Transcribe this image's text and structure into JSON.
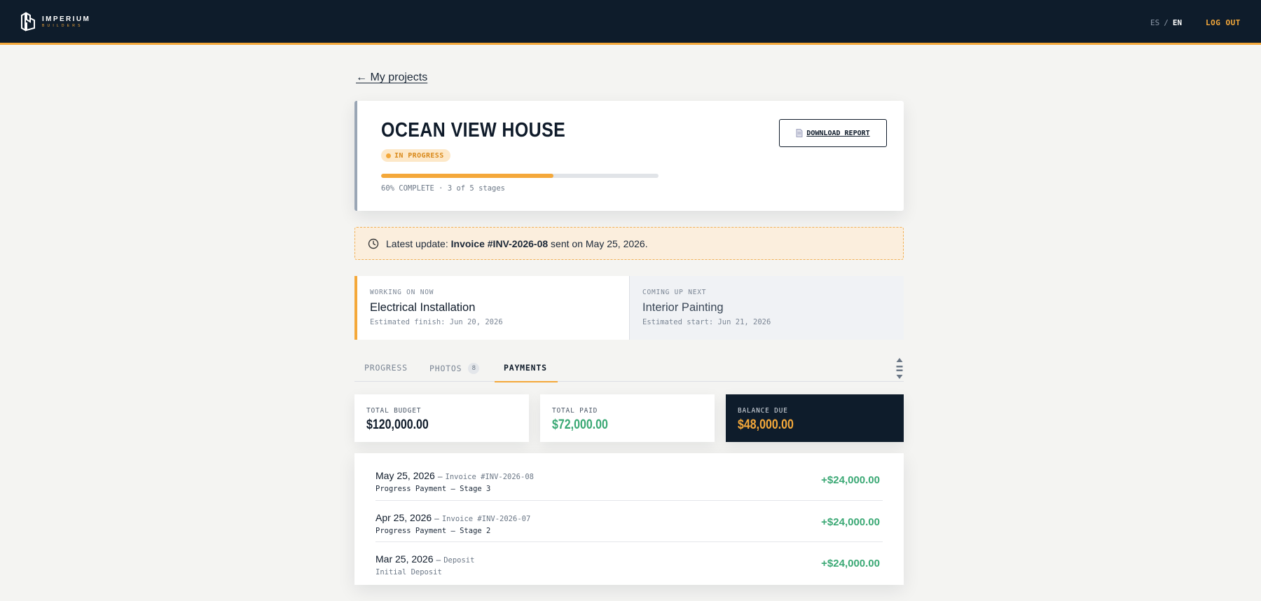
{
  "header": {
    "logo": {
      "name": "IMPERIUM",
      "sub": "BUILDERS"
    },
    "lang": {
      "es": "ES",
      "sep": "/",
      "en": "EN"
    },
    "logout": "LOG OUT",
    "accent": "#f4a83a",
    "background": "#0e1c2b"
  },
  "nav": {
    "back": "← My projects"
  },
  "project": {
    "title": "OCEAN VIEW HOUSE",
    "status": "IN PROGRESS",
    "progress_percent": 62,
    "progress_text": "60% COMPLETE · 3 of 5 stages",
    "download": "DOWNLOAD REPORT"
  },
  "update": {
    "prefix": "Latest update: ",
    "invoice": "Invoice #INV-2026-08",
    "suffix": " sent on May 25, 2026."
  },
  "current": {
    "label": "WORKING ON NOW",
    "name": "Electrical Installation",
    "date": "Estimated finish: Jun 20, 2026"
  },
  "next": {
    "label": "COMING UP NEXT",
    "name": "Interior Painting",
    "date": "Estimated start: Jun 21, 2026"
  },
  "tabs": {
    "progress": "PROGRESS",
    "photos": "PHOTOS",
    "photos_count": "8",
    "payments": "PAYMENTS"
  },
  "summary": {
    "budget_label": "TOTAL BUDGET",
    "budget_value": "$120,000.00",
    "paid_label": "TOTAL PAID",
    "paid_value": "$72,000.00",
    "due_label": "BALANCE DUE",
    "due_value": "$48,000.00"
  },
  "payments": [
    {
      "date": "May 25, 2026",
      "sep": "–",
      "ref": "Invoice #INV-2026-08",
      "desc": "Progress Payment – Stage 3",
      "amount": "+$24,000.00"
    },
    {
      "date": "Apr 25, 2026",
      "sep": "–",
      "ref": "Invoice #INV-2026-07",
      "desc": "Progress Payment – Stage 2",
      "amount": "+$24,000.00"
    },
    {
      "date": "Mar 25, 2026",
      "sep": "–",
      "ref": "Deposit",
      "desc": "Initial Deposit",
      "amount": "+$24,000.00"
    }
  ]
}
